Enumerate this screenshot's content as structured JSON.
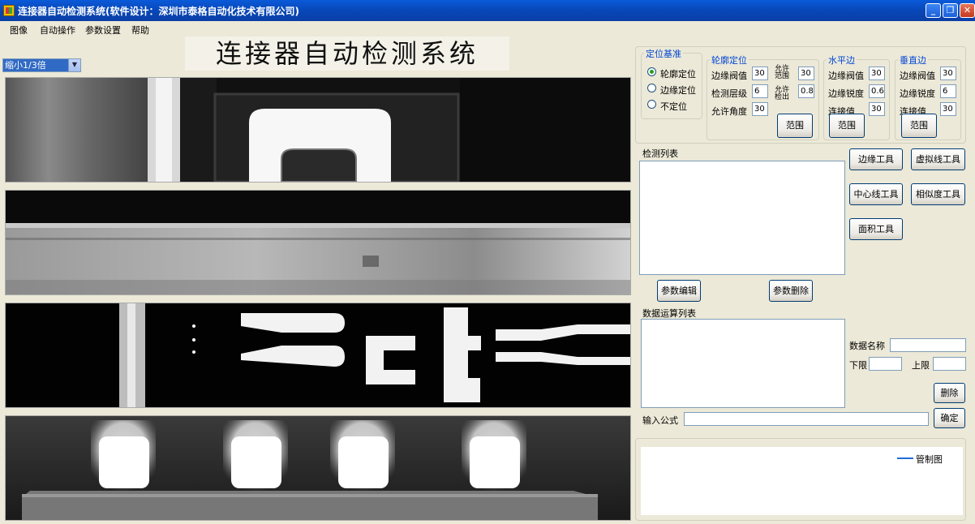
{
  "window": {
    "title": "连接器自动检测系统(软件设计：深圳市泰格自动化技术有限公司)",
    "minimize": "_",
    "maximize": "❐",
    "close": "✕"
  },
  "menu": [
    "图像",
    "自动操作",
    "参数设置",
    "帮助"
  ],
  "banner": "连接器自动检测系统",
  "zoom": {
    "selected": "缩小1/3倍",
    "arrow": "▼"
  },
  "locate_base": {
    "title": "定位基准",
    "options": [
      {
        "label": "轮廓定位",
        "checked": true
      },
      {
        "label": "边缘定位",
        "checked": false
      },
      {
        "label": "不定位",
        "checked": false
      }
    ]
  },
  "contour": {
    "title": "轮廓定位",
    "edge_threshold_label": "边缘阀值",
    "edge_threshold": "30",
    "levels_label": "检测层级",
    "levels": "6",
    "angle_label": "允许角度",
    "angle": "30",
    "range_label": "允许\n范围",
    "range": "30",
    "detect_label": "允许\n检出",
    "detect": "0.8",
    "range_button": "范围"
  },
  "horizontal": {
    "title": "水平边",
    "edge_threshold_label": "边缘阀值",
    "edge_threshold": "30",
    "sharpness_label": "边缘锐度",
    "sharpness": "0.6",
    "connect_label": "连接值",
    "connect": "30",
    "range_button": "范围"
  },
  "vertical": {
    "title": "垂直边",
    "edge_threshold_label": "边缘阀值",
    "edge_threshold": "30",
    "sharpness_label": "边缘锐度",
    "sharpness": "6",
    "connect_label": "连接值",
    "connect": "30",
    "range_button": "范围"
  },
  "detect_list": {
    "label": "检测列表"
  },
  "tools": {
    "edge": "边缘工具",
    "virtual_line": "虚拟线工具",
    "center_line": "中心线工具",
    "similarity": "相似度工具",
    "area": "面积工具"
  },
  "param_buttons": {
    "edit": "参数编辑",
    "delete": "参数删除"
  },
  "data_calc": {
    "label": "数据运算列表",
    "name_label": "数据名称",
    "name_value": "",
    "lower_label": "下限",
    "lower_value": "",
    "upper_label": "上限",
    "upper_value": "",
    "delete": "删除"
  },
  "formula": {
    "label": "输入公式",
    "value": "",
    "confirm": "确定"
  },
  "control_chart": {
    "legend": "管制图",
    "line_color": "#1f6fd6"
  },
  "colors": {
    "title_blue": "#0a5ad9",
    "group_label": "#0046d5"
  }
}
